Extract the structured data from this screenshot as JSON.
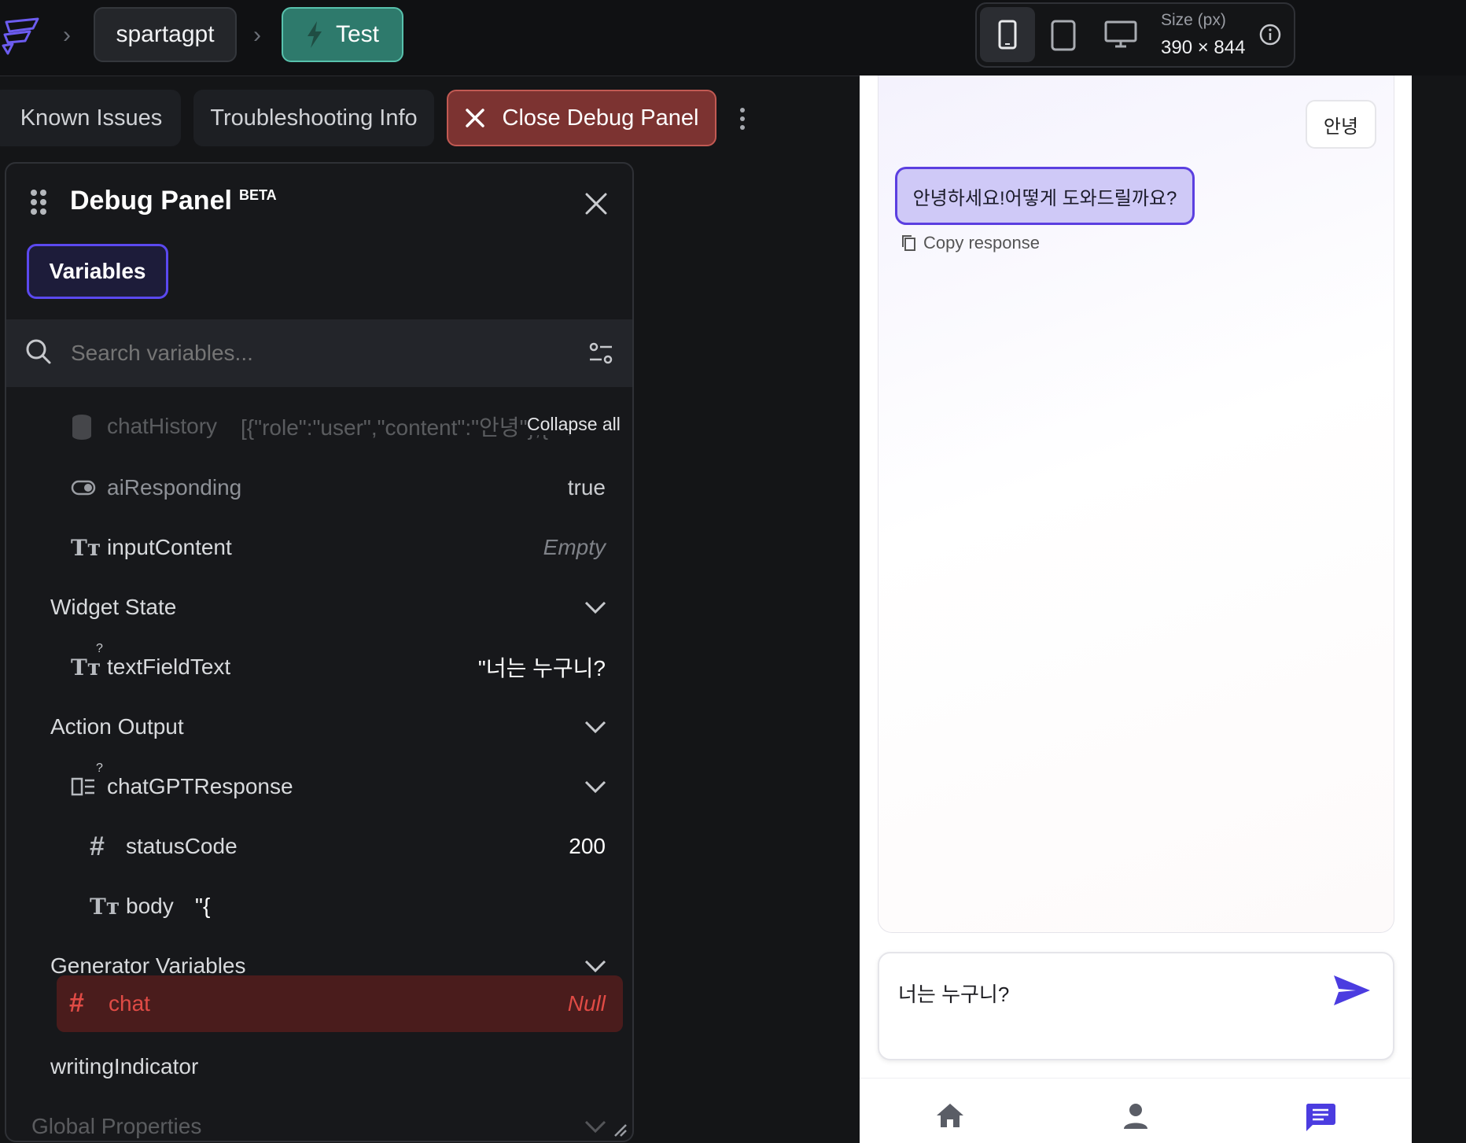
{
  "topbar": {
    "project_name": "spartagpt",
    "test_label": "Test",
    "size_label": "Size (px)",
    "size_value": "390 × 844",
    "accent": "#58c2ad"
  },
  "debug_toolbar": {
    "known_issues": "Known Issues",
    "troubleshooting": "Troubleshooting Info",
    "close_debug": "Close Debug Panel"
  },
  "panel": {
    "title": "Debug Panel",
    "badge": "BETA",
    "tab": "Variables",
    "search_placeholder": "Search variables...",
    "collapse_all": "Collapse all",
    "rows": {
      "chat_history": {
        "name": "chatHistory",
        "value": "[{\"role\":\"user\",\"content\":\"안녕\"},{\"ro..."
      },
      "ai_responding": {
        "name": "aiResponding",
        "value": "true"
      },
      "input_content": {
        "name": "inputContent",
        "value": "Empty"
      },
      "widget_state": {
        "name": "Widget State"
      },
      "text_field_text": {
        "name": "textFieldText",
        "value": "\"너는 누구니?"
      },
      "action_output": {
        "name": "Action Output"
      },
      "chatgpt_response": {
        "name": "chatGPTResponse"
      },
      "status_code": {
        "name": "statusCode",
        "value": "200"
      },
      "body": {
        "name": "body",
        "value": "\"{"
      },
      "generator_variables": {
        "name": "Generator Variables"
      },
      "chat": {
        "name": "chat",
        "value": "Null"
      },
      "writing_indicator": {
        "name": "writingIndicator"
      },
      "global_properties": {
        "name": "Global Properties"
      }
    }
  },
  "preview": {
    "user_message": "안녕",
    "ai_message": "안녕하세요!어떻게 도와드릴까요?",
    "copy_response": "Copy response",
    "input_value": "너는 누구니?",
    "accent": "#4b3ce0"
  }
}
